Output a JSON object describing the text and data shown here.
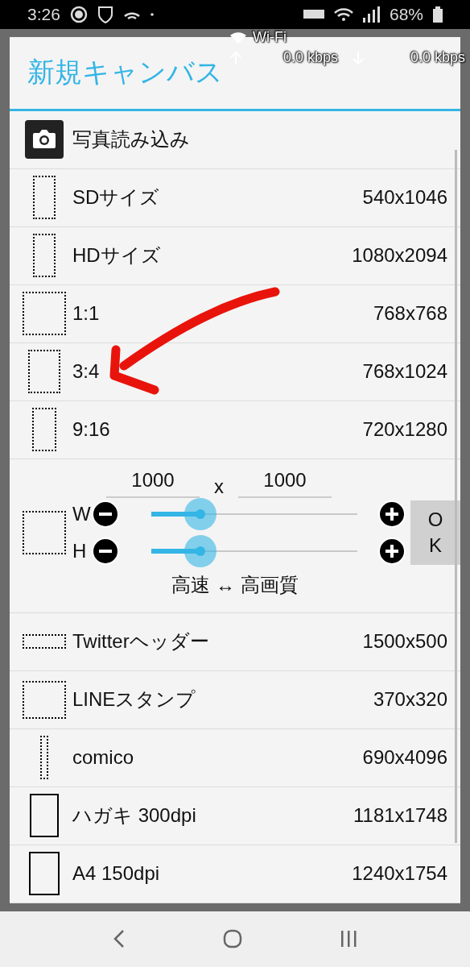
{
  "status_bar": {
    "time": "3:26",
    "battery": "68%"
  },
  "speed_overlay": {
    "network": "Wi-Fi",
    "upload": "0.0 kbps",
    "download": "0.0 kbps"
  },
  "dialog": {
    "title": "新規キャンバス",
    "items": [
      {
        "kind": "photo",
        "label": "写真読み込み"
      },
      {
        "kind": "dotted",
        "label": "SDサイズ",
        "size": "540x1046"
      },
      {
        "kind": "dotted",
        "label": "HDサイズ",
        "size": "1080x2094"
      },
      {
        "kind": "dotted",
        "label": "1:1",
        "size": "768x768"
      },
      {
        "kind": "dotted",
        "label": "3:4",
        "size": "768x1024"
      },
      {
        "kind": "dotted",
        "label": "9:16",
        "size": "720x1280"
      },
      {
        "kind": "custom",
        "width_value": "1000",
        "separator": "x",
        "height_value": "1000",
        "hint": "高速 ↔ 高画質",
        "ok": "OK",
        "sliders": [
          {
            "label": "W",
            "level": 0.24
          },
          {
            "label": "H",
            "level": 0.24
          }
        ]
      },
      {
        "kind": "dotted",
        "label": "Twitterヘッダー",
        "size": "1500x500"
      },
      {
        "kind": "dotted",
        "label": "LINEスタンプ",
        "size": "370x320"
      },
      {
        "kind": "dotted",
        "label": "comico",
        "size": "690x4096"
      },
      {
        "kind": "solid",
        "label": "ハガキ 300dpi",
        "size": "1181x1748"
      },
      {
        "kind": "solid",
        "label": "A4 150dpi",
        "size": "1240x1754"
      }
    ]
  }
}
